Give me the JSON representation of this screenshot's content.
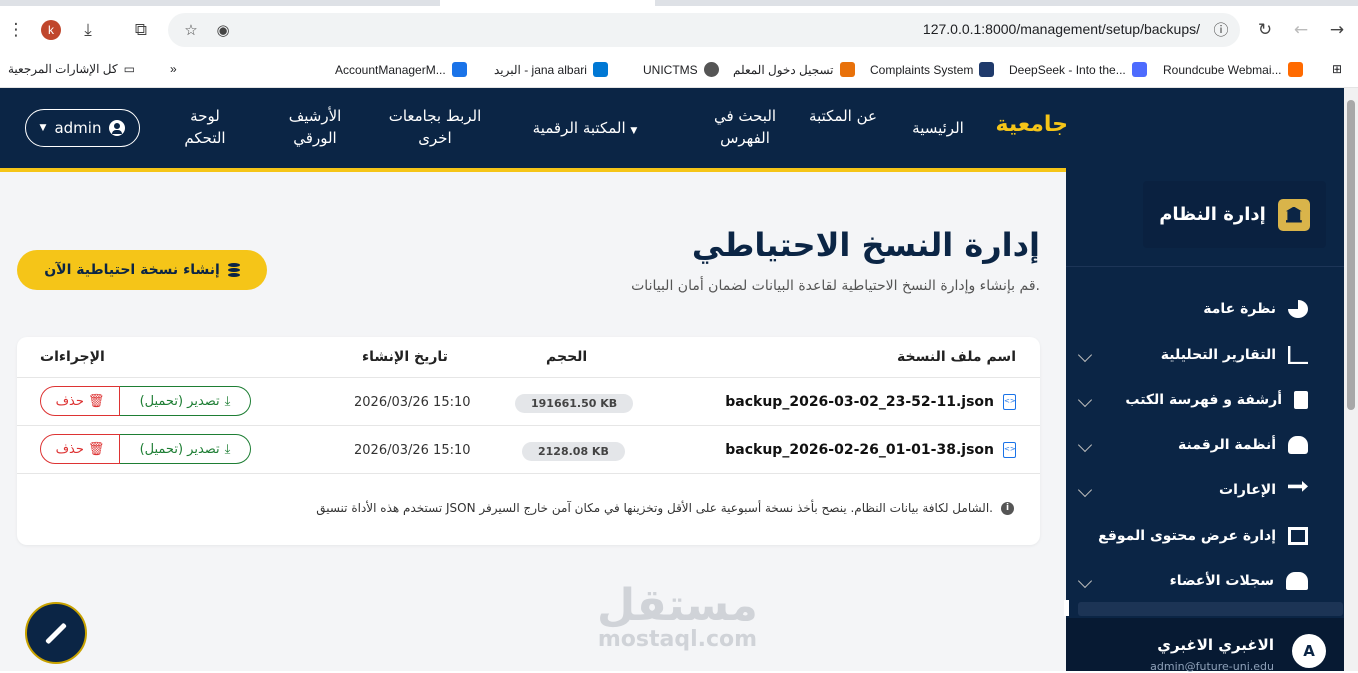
{
  "browser": {
    "url": "127.0.0.1:8000/management/setup/backups/",
    "profile_initial": "k",
    "bookmarks": [
      {
        "label": "Roundcube Webmai...",
        "color": "#ff6a00"
      },
      {
        "label": "DeepSeek - Into the...",
        "color": "#4d6bfe"
      },
      {
        "label": "Complaints System",
        "color": "#1f3a6b"
      },
      {
        "label": "تسجيل دخول المعلم",
        "color": "#e8710a"
      },
      {
        "label": "UNICTMS",
        "color": "#555555"
      },
      {
        "label": "البريد - jana albari",
        "color": "#0078d4"
      },
      {
        "label": "AccountManagerM...",
        "color": "#1a73e8"
      }
    ],
    "all_bookmarks": "كل الإشارات المرجعية"
  },
  "header": {
    "brand": "جامعية",
    "nav": [
      "الرئيسية",
      "عن المكتبة",
      "البحث في الفهرس",
      "المكتبة الرقمية",
      "الربط بجامعات اخرى",
      "الأرشيف الورقي",
      "لوحة التحكم"
    ],
    "admin_label": "admin"
  },
  "main": {
    "title": "إدارة النسخ الاحتياطي",
    "subtitle": "قم بإنشاء وإدارة النسخ الاحتياطية لقاعدة البيانات لضمان أمان البيانات.",
    "create_button": "إنشاء نسخة احتياطية الآن",
    "table": {
      "headers": {
        "name": "اسم ملف النسخة",
        "size": "الحجم",
        "date": "تاريخ الإنشاء",
        "actions": "الإجراءات"
      },
      "rows": [
        {
          "name": "backup_2026-03-02_23-52-11.json",
          "size": "191661.50 KB",
          "date": "2026/03/26 15:10"
        },
        {
          "name": "backup_2026-02-26_01-01-38.json",
          "size": "2128.08 KB",
          "date": "2026/03/26 15:10"
        }
      ],
      "export_label": "تصدير (تحميل)",
      "delete_label": "حذف"
    },
    "note": "تستخدم هذه الأداة تنسيق JSON الشامل لكافة بيانات النظام. ينصح بأخذ نسخة أسبوعية على الأقل وتخزينها في مكان آمن خارج السيرفر.",
    "watermark": {
      "ar": "مستقل",
      "en": "mostaql.com"
    }
  },
  "sidebar": {
    "title": "إدارة النظام",
    "items": [
      {
        "label": "نظرة عامة",
        "icon": "pie-chart-icon",
        "expandable": false
      },
      {
        "label": "التقارير التحليلية",
        "icon": "line-chart-icon",
        "expandable": true
      },
      {
        "label": "أرشفة و فهرسة الكتب",
        "icon": "book-plus-icon",
        "expandable": true
      },
      {
        "label": "أنظمة الرقمنة",
        "icon": "cloud-upload-icon",
        "expandable": true
      },
      {
        "label": "الإعارات",
        "icon": "exchange-icon",
        "expandable": true
      },
      {
        "label": "إدارة عرض محتوى الموقع",
        "icon": "layout-icon",
        "expandable": false
      },
      {
        "label": "سجلات الأعضاء",
        "icon": "users-icon",
        "expandable": true
      }
    ],
    "user": {
      "name": "الاغبري الاغبري",
      "email": "admin@future-uni.edu",
      "initial": "A"
    }
  }
}
